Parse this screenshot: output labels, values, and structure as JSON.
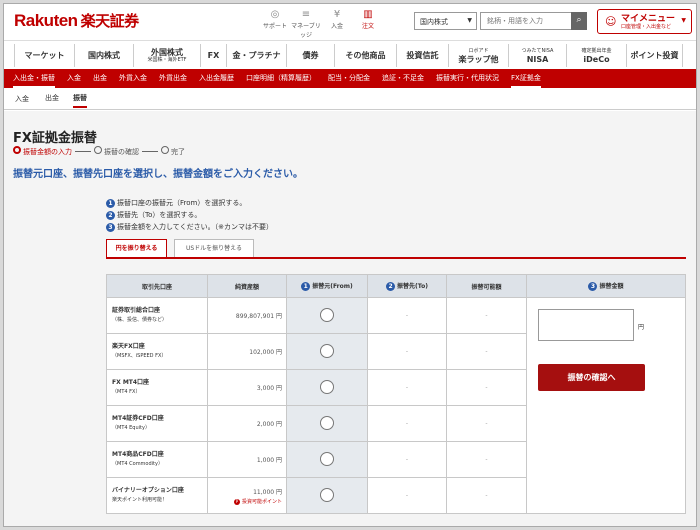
{
  "header": {
    "logo_latin": "Rakuten",
    "logo_jp": "楽天証券",
    "icons": [
      {
        "label": "サポート",
        "icon": "support-icon",
        "glyph": "◎"
      },
      {
        "label": "マネーブリッジ",
        "icon": "money-bridge-icon",
        "glyph": "≡"
      },
      {
        "label": "入金",
        "icon": "deposit-icon",
        "glyph": "¥"
      },
      {
        "label": "注文",
        "icon": "order-icon",
        "glyph": "▥"
      }
    ],
    "market_select": "国内株式",
    "search_placeholder": "銘柄・用語を入力",
    "mymenu_title": "マイメニュー",
    "mymenu_sub": "口座管理・入出金など"
  },
  "global_nav": [
    {
      "label": "マーケット",
      "sub": ""
    },
    {
      "label": "国内株式",
      "sub": ""
    },
    {
      "label": "外国株式",
      "sub": "米国株・海外ETF"
    },
    {
      "label": "FX",
      "sub": ""
    },
    {
      "label": "金・プラチナ",
      "sub": ""
    },
    {
      "label": "債券",
      "sub": ""
    },
    {
      "label": "その他商品",
      "sub": ""
    },
    {
      "label": "投資信託",
      "sub": ""
    },
    {
      "label": "楽ラップ他",
      "sub": "ロボアド"
    },
    {
      "label": "NISA",
      "sub": "つみたてNISA"
    },
    {
      "label": "iDeCo",
      "sub": "確定拠出年金"
    },
    {
      "label": "ポイント投資",
      "sub": ""
    }
  ],
  "sub_nav": [
    "入出金・振替",
    "入金",
    "出金",
    "外貨入金",
    "外貨出金",
    "入出金履歴",
    "口座明細（精算履歴）",
    "配当・分配金",
    "追証・不足金",
    "振替実行・代用状況",
    "FX証拠金"
  ],
  "third_nav": [
    "入金",
    "出金",
    "振替"
  ],
  "page": {
    "title": "FX証拠金振替",
    "steps": [
      "振替金額の入力",
      "振替の確認",
      "完了"
    ],
    "lead": "振替元口座、振替先口座を選択し、振替金額をご入力ください。",
    "instructions": [
      {
        "num": "1",
        "text": "振替口座の振替元（From）を選択する。"
      },
      {
        "num": "2",
        "text": "振替先（To）を選択する。"
      },
      {
        "num": "3",
        "text": "振替金額を入力してください。（※カンマは不要）"
      }
    ],
    "tabs": [
      "円を振り替える",
      "USドルを振り替える"
    ]
  },
  "table": {
    "headers": [
      "取引先口座",
      "純資産額",
      "振替元(From)",
      "振替先(To)",
      "振替可能額",
      "振替金額"
    ],
    "header_nums": [
      "1",
      "2",
      "3"
    ],
    "rows": [
      {
        "name": "証券取引総合口座",
        "sub": "（株、投信、債券など）",
        "amount": "899,807,901 円",
        "to": "-",
        "avail": "-"
      },
      {
        "name": "楽天FX口座",
        "sub": "（MSFX、iSPEED FX）",
        "amount": "102,000 円",
        "to": "-",
        "avail": "-"
      },
      {
        "name": "FX MT4口座",
        "sub": "（MT4 FX）",
        "amount": "3,000 円",
        "to": "-",
        "avail": "-"
      },
      {
        "name": "MT4証券CFD口座",
        "sub": "（MT4 Equity）",
        "amount": "2,000 円",
        "to": "-",
        "avail": "-"
      },
      {
        "name": "MT4商品CFD口座",
        "sub": "（MT4 Commodity）",
        "amount": "1,000 円",
        "to": "-",
        "avail": "-"
      },
      {
        "name": "バイナリーオプション口座",
        "sub": "楽天ポイント利用可能！",
        "amount": "11,000 円",
        "to": "-",
        "avail": "-",
        "point": "投資可能ポイント"
      }
    ],
    "yen_unit": "円",
    "confirm_button": "振替の確認へ"
  }
}
